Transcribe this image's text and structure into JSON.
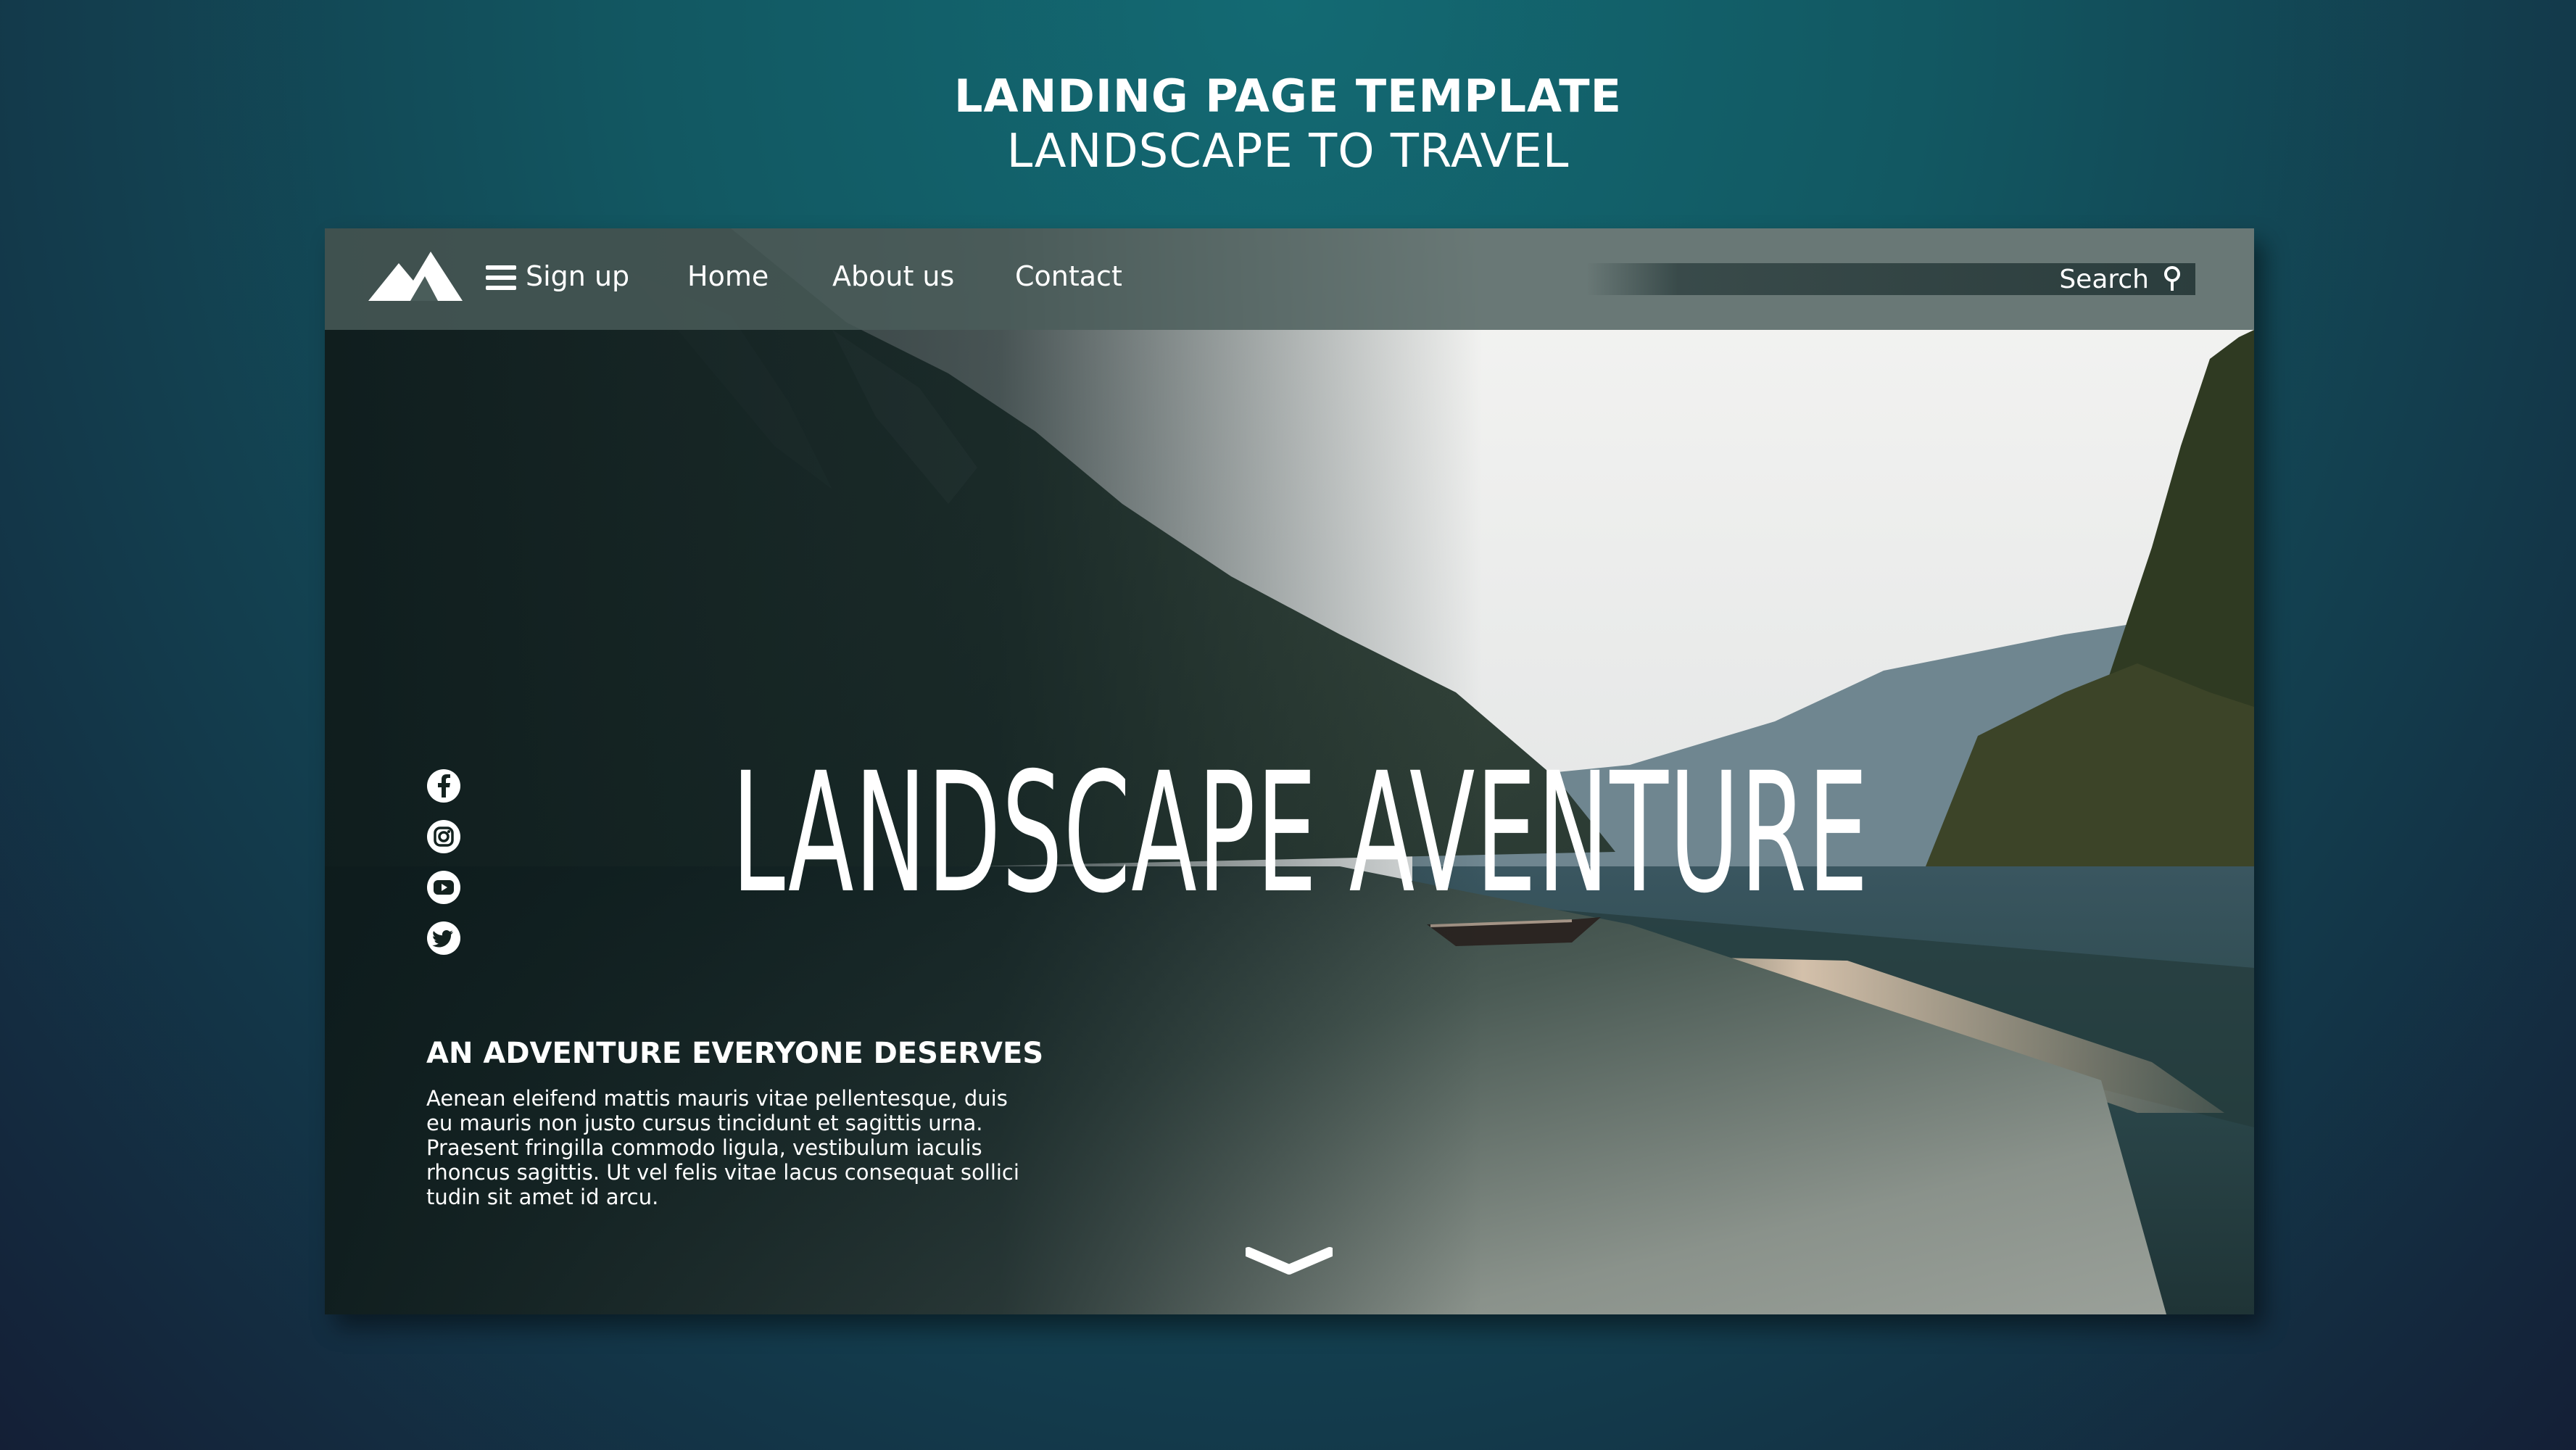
{
  "header": {
    "title": "LANDING PAGE TEMPLATE",
    "subtitle": "LANDSCAPE TO TRAVEL"
  },
  "nav": {
    "logo_icon": "mountain-icon",
    "menu_icon": "hamburger-menu-icon",
    "signup_label": "Sign up",
    "home_label": "Home",
    "about_label": "About us",
    "contact_label": "Contact",
    "search_label": "Search",
    "search_icon": "magnifier-icon"
  },
  "hero": {
    "title": "LANDSCAPE AVENTURE"
  },
  "social": {
    "icons": [
      "facebook-icon",
      "instagram-icon",
      "youtube-icon",
      "twitter-icon"
    ]
  },
  "intro": {
    "heading": "AN ADVENTURE EVERYONE DESERVES",
    "lines": [
      "Aenean eleifend mattis mauris vitae pellentesque, duis",
      "eu mauris non justo cursus tincidunt et sagittis urna.",
      "Praesent fringilla commodo ligula, vestibulum iaculis",
      "rhoncus sagittis. Ut vel felis vitae lacus consequat sollici",
      "tudin sit amet id arcu."
    ]
  },
  "scroll": {
    "icon": "chevron-down-icon"
  },
  "colors": {
    "background_top": "#136a73",
    "background_bottom": "#141f36",
    "navbar": "#4a5d5a",
    "text": "#ffffff"
  }
}
